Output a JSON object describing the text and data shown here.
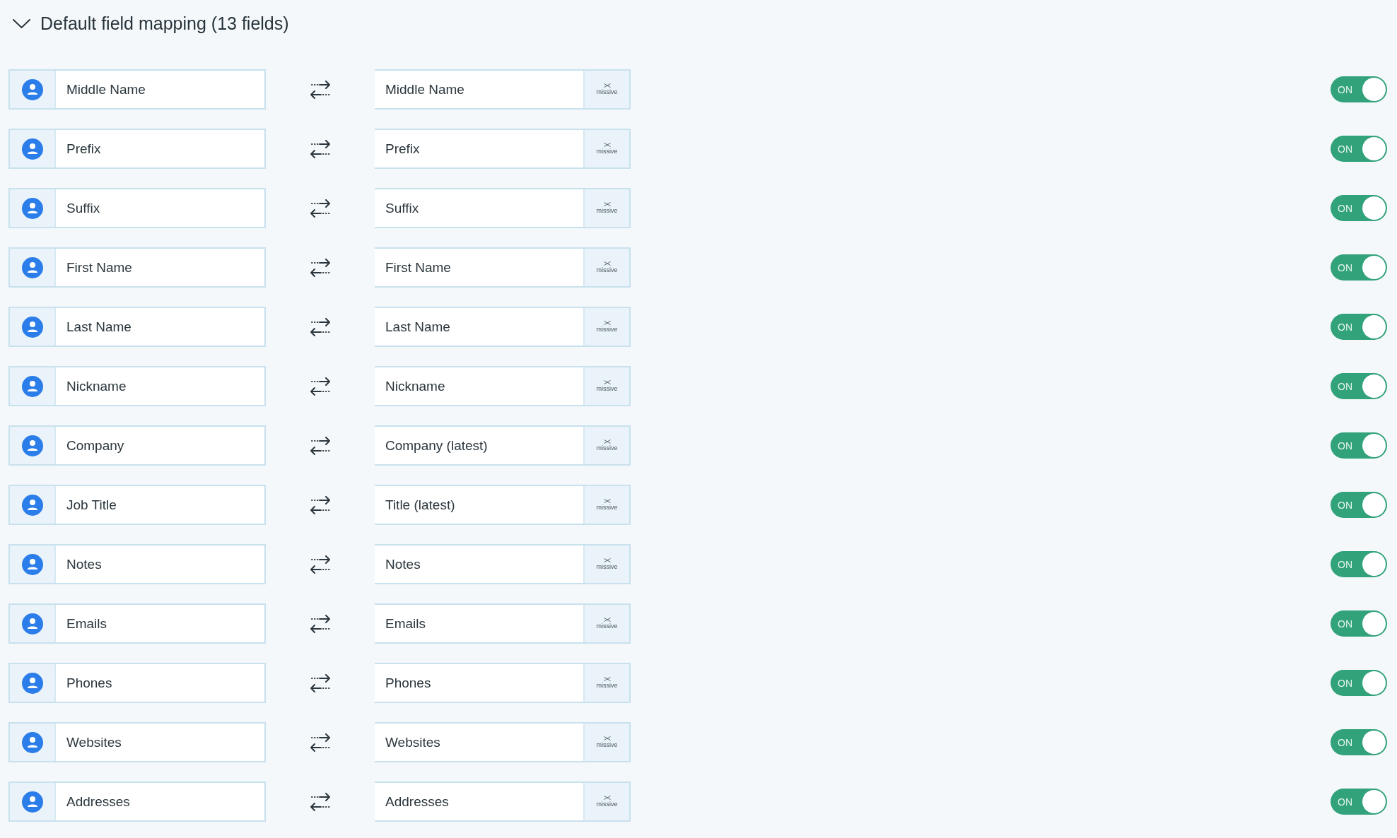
{
  "section": {
    "title": "Default field mapping (13 fields)",
    "expanded": true
  },
  "mappings": [
    {
      "source": "Middle Name",
      "target": "Middle Name",
      "target_app": "missive",
      "toggle_label": "ON",
      "on": true
    },
    {
      "source": "Prefix",
      "target": "Prefix",
      "target_app": "missive",
      "toggle_label": "ON",
      "on": true
    },
    {
      "source": "Suffix",
      "target": "Suffix",
      "target_app": "missive",
      "toggle_label": "ON",
      "on": true
    },
    {
      "source": "First Name",
      "target": "First Name",
      "target_app": "missive",
      "toggle_label": "ON",
      "on": true
    },
    {
      "source": "Last Name",
      "target": "Last Name",
      "target_app": "missive",
      "toggle_label": "ON",
      "on": true
    },
    {
      "source": "Nickname",
      "target": "Nickname",
      "target_app": "missive",
      "toggle_label": "ON",
      "on": true
    },
    {
      "source": "Company",
      "target": "Company (latest)",
      "target_app": "missive",
      "toggle_label": "ON",
      "on": true
    },
    {
      "source": "Job Title",
      "target": "Title (latest)",
      "target_app": "missive",
      "toggle_label": "ON",
      "on": true
    },
    {
      "source": "Notes",
      "target": "Notes",
      "target_app": "missive",
      "toggle_label": "ON",
      "on": true
    },
    {
      "source": "Emails",
      "target": "Emails",
      "target_app": "missive",
      "toggle_label": "ON",
      "on": true
    },
    {
      "source": "Phones",
      "target": "Phones",
      "target_app": "missive",
      "toggle_label": "ON",
      "on": true
    },
    {
      "source": "Websites",
      "target": "Websites",
      "target_app": "missive",
      "toggle_label": "ON",
      "on": true
    },
    {
      "source": "Addresses",
      "target": "Addresses",
      "target_app": "missive",
      "toggle_label": "ON",
      "on": true
    }
  ]
}
